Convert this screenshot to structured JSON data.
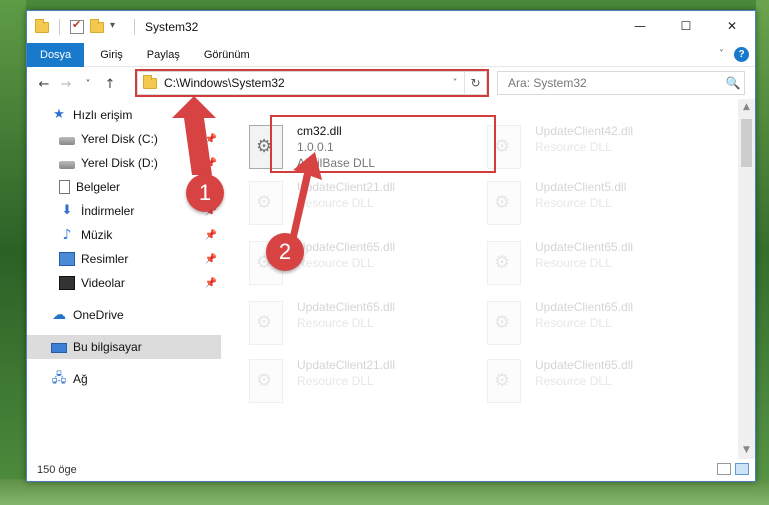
{
  "window": {
    "title": "System32",
    "controls": {
      "minimize": "—",
      "maximize": "☐",
      "close": "✕"
    }
  },
  "ribbon": {
    "tabs": [
      "Dosya",
      "Giriş",
      "Paylaş",
      "Görünüm"
    ],
    "help": "?",
    "expand": "˅"
  },
  "nav": {
    "back": "←",
    "forward": "→",
    "recent": "˅",
    "up": "↑",
    "address": "C:\\Windows\\System32",
    "address_dropdown": "˅",
    "refresh": "↻",
    "search_placeholder": "Ara: System32",
    "search_icon": "🔍"
  },
  "sidebar": {
    "items": [
      {
        "label": "Hızlı erişim",
        "icon": "star-icon"
      },
      {
        "label": "Yerel Disk (C:)",
        "icon": "disk-icon",
        "pinned": true
      },
      {
        "label": "Yerel Disk (D:)",
        "icon": "disk-icon",
        "pinned": true
      },
      {
        "label": "Belgeler",
        "icon": "document-icon",
        "pinned": true
      },
      {
        "label": "İndirmeler",
        "icon": "download-icon",
        "pinned": true
      },
      {
        "label": "Müzik",
        "icon": "music-icon",
        "pinned": true
      },
      {
        "label": "Resimler",
        "icon": "pictures-icon",
        "pinned": true
      },
      {
        "label": "Videolar",
        "icon": "videos-icon",
        "pinned": true
      },
      {
        "label": "OneDrive",
        "icon": "cloud-icon"
      },
      {
        "label": "Bu bilgisayar",
        "icon": "computer-icon",
        "selected": true
      },
      {
        "label": "Ağ",
        "icon": "network-icon"
      }
    ],
    "pin_glyph": "📌"
  },
  "files": {
    "primary": {
      "name": "cm32.dll",
      "version": "1.0.0.1",
      "description": "AUtilBase DLL"
    },
    "ghost": [
      {
        "name": "UpdateClient42.dll",
        "sub": "Resource DLL"
      },
      {
        "name": "UpdateClient21.dll",
        "sub": "Resource DLL"
      },
      {
        "name": "UpdateClient5.dll",
        "sub": "Resource DLL"
      },
      {
        "name": "UpdateClient65.dll",
        "sub": "Resource DLL"
      },
      {
        "name": "UpdateClient65.dll",
        "sub": "Resource DLL"
      },
      {
        "name": "UpdateClient65.dll",
        "sub": "Resource DLL"
      },
      {
        "name": "UpdateClient65.dll",
        "sub": "Resource DLL"
      },
      {
        "name": "UpdateClient21.dll",
        "sub": "Resource DLL"
      },
      {
        "name": "UpdateClient65.dll",
        "sub": "Resource DLL"
      }
    ]
  },
  "status": {
    "count": "150 öge"
  },
  "callouts": [
    "1",
    "2"
  ],
  "colors": {
    "accent": "#1979ca",
    "highlight": "#d23c3c",
    "callout": "#d74343"
  }
}
